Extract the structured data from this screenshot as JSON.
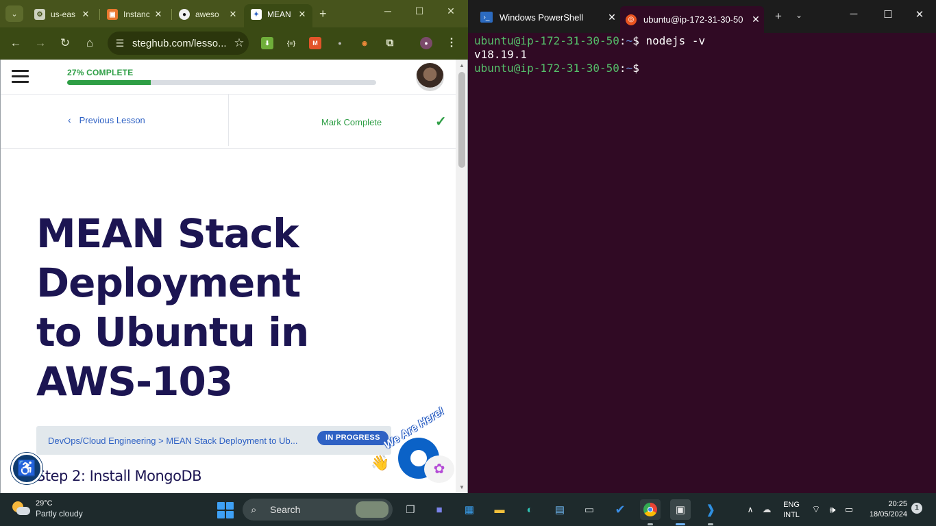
{
  "browser": {
    "tabs": [
      {
        "title": "us-eas",
        "favicon": "aws-icon",
        "active": false
      },
      {
        "title": "Instanc",
        "favicon": "ec2-icon",
        "active": false
      },
      {
        "title": "aweso",
        "favicon": "github-icon",
        "active": false
      },
      {
        "title": "MEAN",
        "favicon": "steghub-icon",
        "active": true
      }
    ],
    "url": "steghub.com/lesso..."
  },
  "lesson": {
    "progress_label": "27% COMPLETE",
    "progress_value": 0.27,
    "prev_label": "Previous Lesson",
    "mark_label": "Mark Complete",
    "title": "MEAN Stack Deployment to Ubuntu in AWS-103",
    "breadcrumb": "DevOps/Cloud Engineering > MEAN Stack Deployment to Ub...",
    "status_badge": "IN PROGRESS",
    "step_heading": "Step 2: Install MongoDB",
    "chat_text": "We Are Here!"
  },
  "terminal": {
    "tabs": [
      {
        "title": "Windows PowerShell",
        "active": false
      },
      {
        "title": "ubuntu@ip-172-31-30-50",
        "active": true
      }
    ],
    "lines": [
      {
        "user": "ubuntu@ip-172-31-30-50",
        "path": "~",
        "cmd": " nodejs -v"
      },
      {
        "output": "v18.19.1"
      },
      {
        "user": "ubuntu@ip-172-31-30-50",
        "path": "~",
        "cmd": ""
      }
    ]
  },
  "taskbar": {
    "weather_temp": "29°C",
    "weather_cond": "Partly cloudy",
    "search_label": "Search",
    "lang_top": "ENG",
    "lang_bottom": "INTL",
    "time": "20:25",
    "date": "18/05/2024",
    "notifications": "1"
  },
  "colors": {
    "chrome_frame": "#47541c",
    "terminal_bg": "#300a24",
    "progress_green": "#2e9e45",
    "link_blue": "#2e61c4",
    "title_navy": "#1c1552"
  }
}
